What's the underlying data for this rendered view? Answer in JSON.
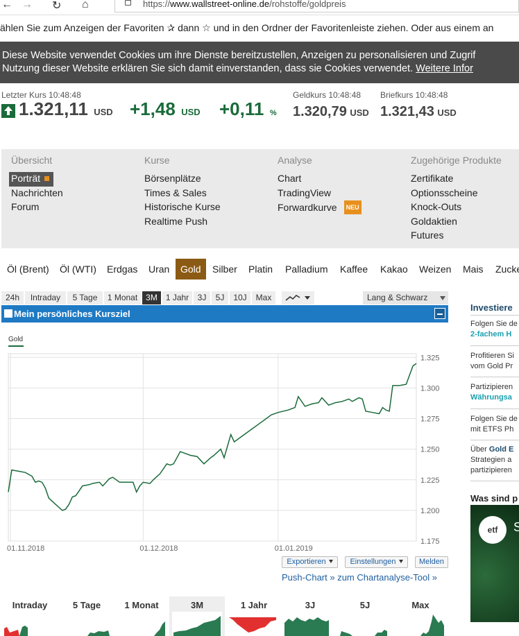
{
  "browser": {
    "url_prefix": "https://",
    "url_domain": "www.wallstreet-online.de",
    "url_path": "/rohstoffe/goldpreis"
  },
  "favorites_bar": {
    "text": "ählen Sie zum Anzeigen der Favoriten  ✰  dann ☆ und in den Ordner der Favoritenleiste ziehen. Oder aus einem an"
  },
  "cookie_banner": {
    "line1": "Diese Website verwendet Cookies um ihre Dienste bereitzustellen, Anzeigen zu personalisieren und Zugrif",
    "line2": "Nutzung dieser Website erklären Sie sich damit einverstanden, dass sie Cookies verwendet.",
    "more_link": "Weitere Infor"
  },
  "quote": {
    "last_label": "Letzter Kurs 10:48:48",
    "last_value": "1.321,11",
    "currency": "USD",
    "change_abs": "+1,48",
    "change_pct": "+0,11",
    "pct_sign": "%",
    "bid_label": "Geldkurs 10:48:48",
    "bid_value": "1.320,79",
    "ask_label": "Briefkurs 10:48:48",
    "ask_value": "1.321,43",
    "trend_icon": "arrow-up-icon",
    "trend_color": "#1a6b3a"
  },
  "nav": {
    "columns": [
      {
        "head": "Übersicht",
        "items": [
          "Porträt",
          "Nachrichten",
          "Forum"
        ]
      },
      {
        "head": "Kurse",
        "items": [
          "Börsenplätze",
          "Times & Sales",
          "Historische Kurse",
          "Realtime Push"
        ]
      },
      {
        "head": "Analyse",
        "items": [
          "Chart",
          "TradingView",
          "Forwardkurve"
        ]
      },
      {
        "head": "Zugehörige Produkte",
        "items": [
          "Zertifikate",
          "Optionsscheine",
          "Knock-Outs",
          "Goldaktien",
          "Futures"
        ]
      }
    ],
    "new_badge": "NEU"
  },
  "commodity_tabs": [
    "Öl (Brent)",
    "Öl (WTI)",
    "Erdgas",
    "Uran",
    "Gold",
    "Silber",
    "Platin",
    "Palladium",
    "Kaffee",
    "Kakao",
    "Weizen",
    "Mais",
    "Zucke"
  ],
  "range_bar": {
    "ranges": [
      "24h",
      "Intraday",
      "5 Tage",
      "1 Monat",
      "3M",
      "1 Jahr",
      "3J",
      "5J",
      "10J",
      "Max"
    ],
    "active": "3M",
    "exchange": "Lang & Schwarz"
  },
  "kursziel": "Mein persönliches Kursziel",
  "chart_data": {
    "type": "line",
    "series": [
      {
        "name": "Gold",
        "color": "#1a6b3a"
      }
    ],
    "y_ticks": [
      "1.325",
      "1.300",
      "1.275",
      "1.250",
      "1.225",
      "1.200",
      "1.175"
    ],
    "x_ticks": [
      "01.11.2018",
      "01.12.2018",
      "01.01.2019"
    ],
    "ylim": [
      1175,
      1328
    ],
    "grid": true,
    "points": [
      [
        0,
        1215
      ],
      [
        1,
        1233
      ],
      [
        3,
        1232
      ],
      [
        5,
        1231
      ],
      [
        7,
        1228
      ],
      [
        8,
        1223
      ],
      [
        9,
        1224
      ],
      [
        10,
        1223
      ],
      [
        11,
        1218
      ],
      [
        12,
        1210
      ],
      [
        14,
        1205
      ],
      [
        16,
        1200
      ],
      [
        17,
        1201
      ],
      [
        18,
        1205
      ],
      [
        19,
        1211
      ],
      [
        20,
        1212
      ],
      [
        22,
        1220
      ],
      [
        24,
        1221
      ],
      [
        25,
        1222
      ],
      [
        27,
        1223
      ],
      [
        28,
        1220
      ],
      [
        30,
        1226
      ],
      [
        31,
        1227
      ],
      [
        33,
        1223
      ],
      [
        35,
        1223
      ],
      [
        37,
        1223
      ],
      [
        38,
        1215
      ],
      [
        39,
        1220
      ],
      [
        40,
        1223
      ],
      [
        42,
        1222
      ],
      [
        43,
        1225
      ],
      [
        45,
        1230
      ],
      [
        47,
        1238
      ],
      [
        48,
        1237
      ],
      [
        49,
        1238
      ],
      [
        51,
        1248
      ],
      [
        52,
        1247
      ],
      [
        54,
        1245
      ],
      [
        56,
        1244
      ],
      [
        58,
        1238
      ],
      [
        60,
        1243
      ],
      [
        61,
        1245
      ],
      [
        63,
        1250
      ],
      [
        64,
        1243
      ],
      [
        66,
        1262
      ],
      [
        67,
        1256
      ],
      [
        69,
        1260
      ],
      [
        72,
        1266
      ],
      [
        75,
        1272
      ],
      [
        78,
        1278
      ],
      [
        80,
        1280
      ],
      [
        83,
        1282
      ],
      [
        85,
        1284
      ],
      [
        86,
        1293
      ],
      [
        88,
        1285
      ],
      [
        90,
        1287
      ],
      [
        92,
        1288
      ],
      [
        93,
        1292
      ],
      [
        95,
        1286
      ],
      [
        97,
        1288
      ],
      [
        99,
        1289
      ],
      [
        101,
        1291
      ],
      [
        102,
        1289
      ],
      [
        104,
        1292
      ],
      [
        105,
        1291
      ],
      [
        106,
        1281
      ],
      [
        108,
        1280
      ],
      [
        110,
        1279
      ],
      [
        111,
        1284
      ],
      [
        112,
        1282
      ],
      [
        113,
        1281
      ],
      [
        114,
        1302
      ],
      [
        116,
        1302
      ],
      [
        118,
        1303
      ],
      [
        120,
        1318
      ],
      [
        121,
        1320
      ]
    ],
    "x_domain": [
      0,
      121
    ],
    "x_tick_pos": [
      0,
      40,
      80
    ]
  },
  "buttons": {
    "export": "Exportieren",
    "settings": "Einstellungen",
    "report": "Melden"
  },
  "push_links": "Push-Chart » zum Chartanalyse-Tool »",
  "mini_charts": [
    "Intraday",
    "5 Tage",
    "1 Monat",
    "3M",
    "1 Jahr",
    "3J",
    "5J",
    "Max"
  ],
  "sidebar": {
    "title": "Investiere",
    "items": [
      {
        "line1": "Folgen Sie de",
        "line2": "2-fachem H"
      },
      {
        "line1": "Profitieren Si",
        "line2": "vom Gold Pr"
      },
      {
        "line1": "Partizipieren",
        "line2": "Währungsa"
      },
      {
        "line1": "Folgen Sie de",
        "line2": "mit ETFS Ph"
      },
      {
        "line1": "Über",
        "bold": "Gold E",
        "line2": "Strategien a",
        "line3": "partizipieren"
      }
    ],
    "section2": "Was sind p",
    "video_logo": "etf",
    "video_letter": "S"
  }
}
